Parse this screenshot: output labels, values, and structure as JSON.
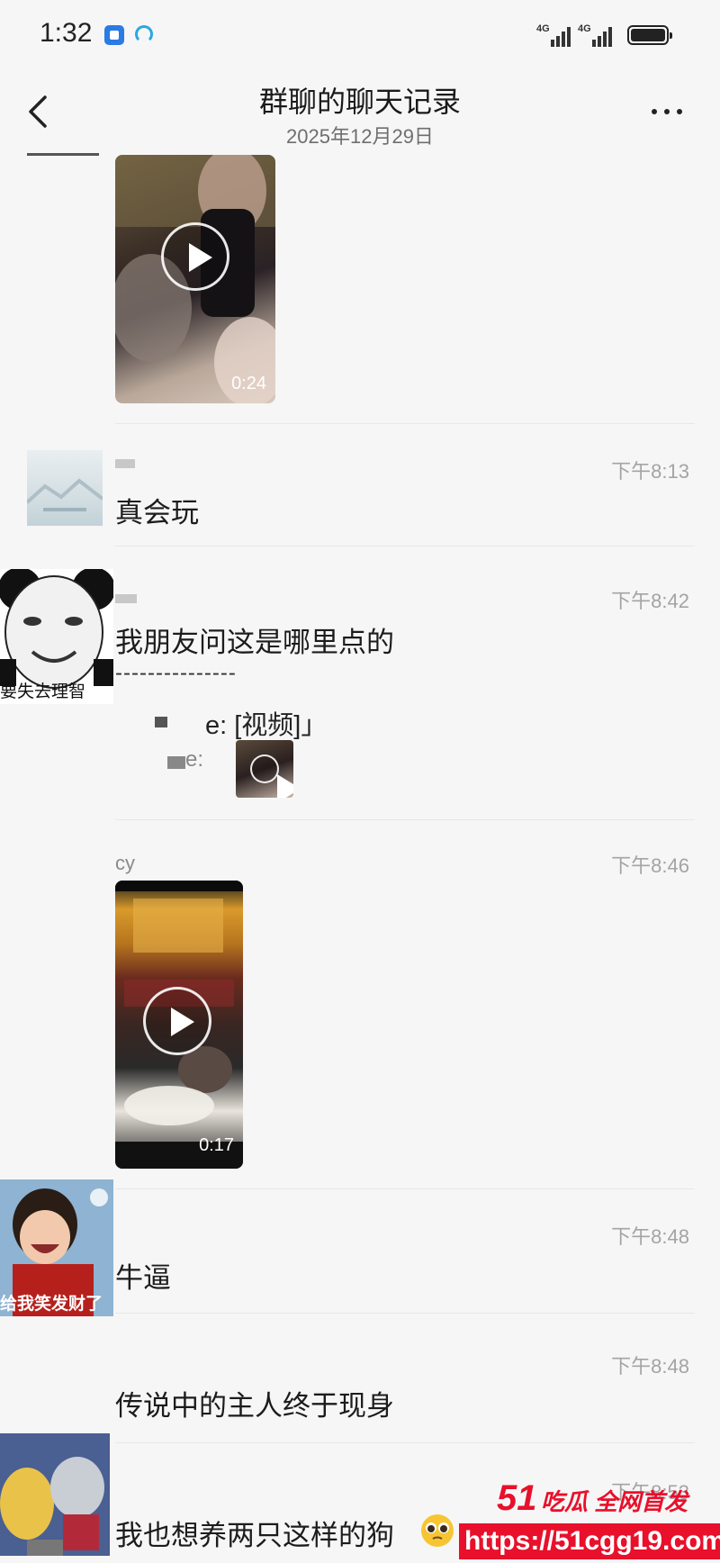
{
  "status": {
    "time": "1:32",
    "net1": "4G",
    "net2": "4G"
  },
  "header": {
    "title": "群聊的聊天记录",
    "date": "2025年12月29日"
  },
  "messages": [
    {
      "video_duration": "0:24"
    },
    {
      "time": "下午8:13",
      "text": "真会玩"
    },
    {
      "time": "下午8:42",
      "text": "我朋友问这是哪里点的",
      "dashes": "---------------",
      "quote1": "e: [视频]」",
      "quote2": "e:",
      "avatar_caption": "要失去理智"
    },
    {
      "time": "下午8:46",
      "sender": "cy",
      "video_duration": "0:17"
    },
    {
      "time": "下午8:48",
      "text": "牛逼",
      "avatar_caption": "给我笑发财了"
    },
    {
      "time": "下午8:48",
      "text": "传说中的主人终于现身"
    },
    {
      "time": "下午8:53",
      "text": "我也想养两只这样的狗"
    }
  ],
  "watermark": {
    "num": "51",
    "tag": "吃瓜 全网首发",
    "url": "https://51cgg19.com"
  },
  "colors": {
    "background": "#f6f6f6",
    "time_text": "#a4a4a4",
    "watermark_red": "#e8102b"
  }
}
